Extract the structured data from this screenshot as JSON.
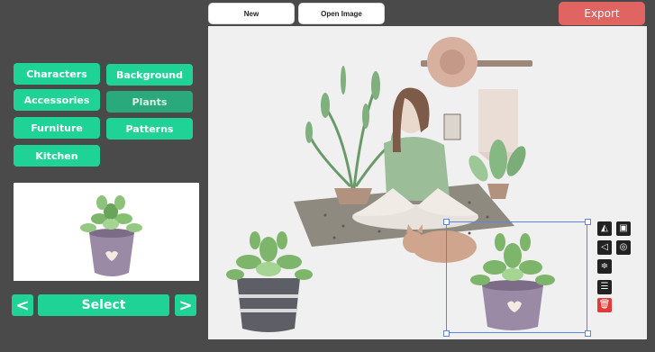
{
  "toolbar": {
    "new_label": "New",
    "open_label": "Open Image",
    "export_label": "Export"
  },
  "categories": [
    {
      "label": "Characters"
    },
    {
      "label": "Background"
    },
    {
      "label": "Accessories"
    },
    {
      "label": "Plants",
      "active": true
    },
    {
      "label": "Furniture"
    },
    {
      "label": "Patterns"
    },
    {
      "label": "Kitchen"
    }
  ],
  "picker": {
    "prev_label": "<",
    "select_label": "Select",
    "next_label": ">"
  },
  "tools": [
    "flip-horizontal-icon",
    "bring-forward-icon",
    "flip-vertical-icon",
    "send-backward-icon",
    "align-center-icon",
    "align-bottom-icon",
    "delete-icon"
  ],
  "colors": {
    "accent": "#1fd396",
    "export": "#e06462",
    "background": "#4a4a4a",
    "selection": "#5b86e5"
  }
}
